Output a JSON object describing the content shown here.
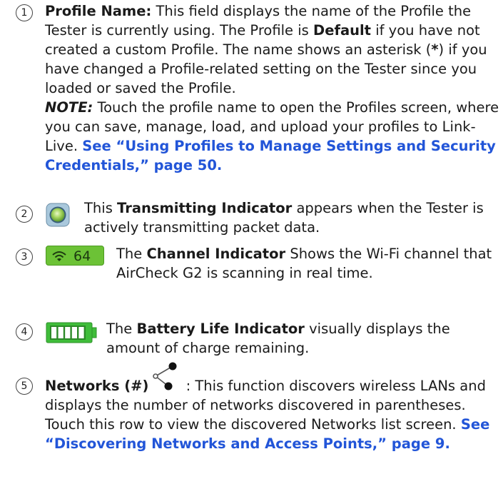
{
  "items": [
    {
      "number": "1",
      "label": "Profile Name:",
      "t1": " This field displays the name of the Profile the Tester is currently using. The Profile is ",
      "default_word": "Default",
      "t2": " if you have not created a custom Profile. The name shows an asterisk (",
      "asterisk": "*",
      "t3": ") if you have changed a Profile-related setting on the Tester since you loaded or saved the Profile.",
      "note_label": "NOTE:",
      "note_text": " Touch the profile name to open the Profiles screen, where you can save, manage, load, and upload your profiles to Link-Live. ",
      "link": "See “Using Profiles to Manage Settings and Security Credentials,” page 50."
    },
    {
      "number": "2",
      "icon": "transmitting-indicator-icon",
      "t1": "This ",
      "bold": "Transmitting Indicator",
      "t2": " appears when the Tester is actively transmitting packet data."
    },
    {
      "number": "3",
      "icon": "wifi-icon",
      "channel_value": "64",
      "t1": "The ",
      "bold": "Channel Indicator",
      "t2": " Shows the Wi-Fi channel that AirCheck G2 is scanning in real time."
    },
    {
      "number": "4",
      "icon": "battery-icon",
      "battery_level": 1.0,
      "t1": "The ",
      "bold": "Battery Life Indicator",
      "t2": " visually displays the amount of charge remaining."
    },
    {
      "number": "5",
      "bold": "Networks (#)",
      "icon": "share-network-icon",
      "t1": " : This function discovers wireless LANs and displays the number of networks discovered in parentheses. Touch this row to view the discovered Networks list screen. ",
      "link": "See “Discovering Networks and Access Points,” page 9."
    }
  ],
  "colors": {
    "link": "#2255d8",
    "channel_bg": "#6cc236",
    "battery": "#3fbd3a",
    "transmit": "#9fd05a"
  }
}
